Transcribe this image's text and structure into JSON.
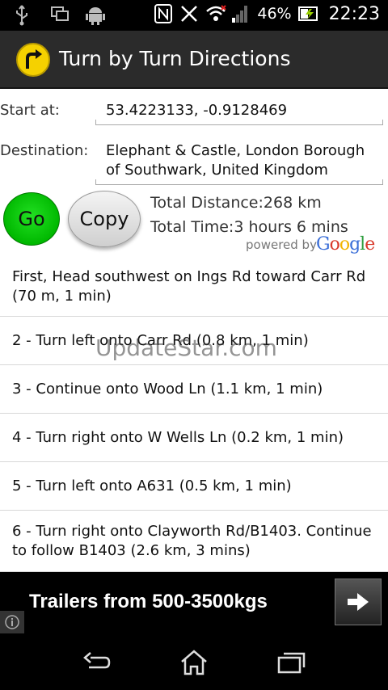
{
  "status_bar": {
    "battery": "46%",
    "time": "22:23",
    "icons": [
      "usb-icon",
      "screen-icon",
      "android-icon",
      "nfc-icon",
      "vibrate-off-icon",
      "wifi-icon",
      "signal-icon",
      "battery-charging-icon"
    ]
  },
  "action_bar": {
    "title": "Turn by Turn Directions",
    "icon": "turn-right-arrow-icon"
  },
  "form": {
    "start_label": "Start at:",
    "start_value": "53.4223133, -0.9128469",
    "destination_label": "Destination:",
    "destination_line1": "Elephant & Castle, London Borough",
    "destination_line2": "of Southwark, United Kingdom"
  },
  "buttons": {
    "go": "Go",
    "copy": "Copy"
  },
  "summary": {
    "distance": "Total Distance:268 km",
    "time": "Total Time:3 hours 6 mins",
    "powered_by": "powered by",
    "google_letters": [
      "G",
      "o",
      "o",
      "g",
      "l",
      "e"
    ],
    "google_colors": [
      "#3b6fd8",
      "#d93a2b",
      "#f2b400",
      "#3b6fd8",
      "#2f9e3f",
      "#d93a2b"
    ]
  },
  "steps": [
    "First, Head southwest on Ings Rd toward Carr Rd (70 m, 1 min)",
    "2 - Turn left onto Carr Rd (0.8 km, 1 min)",
    "3 - Continue onto Wood Ln (1.1 km, 1 min)",
    "4 - Turn right onto W Wells Ln (0.2 km, 1 min)",
    "5 - Turn left onto A631 (0.5 km, 1 min)",
    "6 - Turn right onto Clayworth Rd/B1403. Continue to follow B1403 (2.6 km, 3 mins)"
  ],
  "watermark": "UpdateStar.com",
  "ad": {
    "text": "Trailers from 500-3500kgs"
  },
  "colors": {
    "go_green": "#00c800",
    "actionbar": "#2b2b2b",
    "app_icon_yellow": "#f5d100"
  }
}
